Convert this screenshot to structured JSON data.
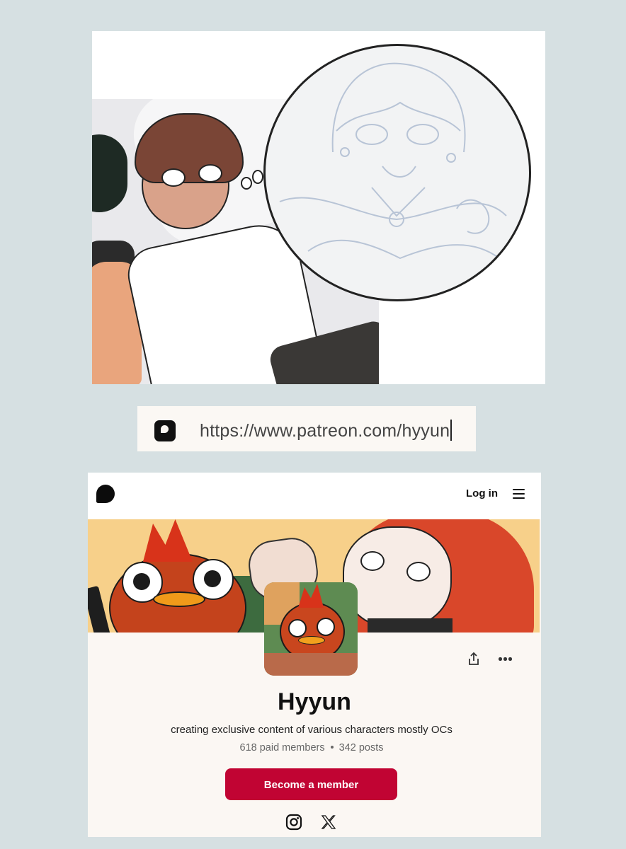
{
  "url_bar": {
    "url": "https://www.patreon.com/hyyun",
    "favicon": "patreon-favicon-icon"
  },
  "artwork": {
    "description_icon": "comic-artwork-image"
  },
  "nav": {
    "logo_icon": "patreon-logo-icon",
    "login_label": "Log in",
    "menu_icon": "hamburger-menu-icon"
  },
  "profile": {
    "name": "Hyyun",
    "tagline": "creating exclusive content of various characters mostly OCs",
    "paid_members": "618 paid members",
    "posts": "342 posts",
    "cta_label": "Become a member",
    "share_icon": "share-icon",
    "more_icon": "more-options-icon",
    "socials": [
      "instagram-icon",
      "x-twitter-icon"
    ]
  },
  "colors": {
    "page_bg": "#d6e0e2",
    "cta": "#c10433",
    "card_bg": "#fbf7f3",
    "banner_bg": "#f7d08a"
  }
}
